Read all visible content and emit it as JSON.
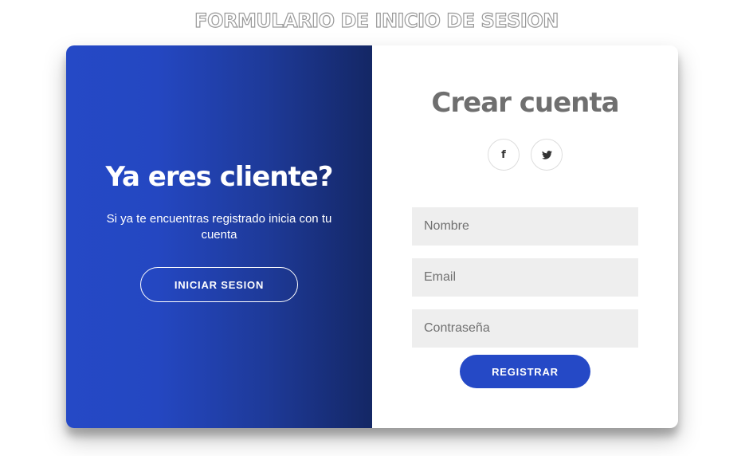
{
  "page": {
    "title": "FORMULARIO DE INICIO DE SESION"
  },
  "colors": {
    "accent": "#2549c6",
    "gradient_start": "#2549c6",
    "gradient_end": "#142765",
    "input_background": "#eeeeee",
    "form_title": "#6f6f6f"
  },
  "overlay": {
    "title": "Ya eres cliente?",
    "text": "Si ya te encuentras registrado inicia con tu cuenta",
    "button_label": "INICIAR SESION"
  },
  "form": {
    "title": "Crear cuenta",
    "social": [
      {
        "icon": "facebook-icon",
        "glyph": "f"
      },
      {
        "icon": "twitter-icon",
        "glyph": "🐦"
      }
    ],
    "fields": {
      "name_placeholder": "Nombre",
      "email_placeholder": "Email",
      "password_placeholder": "Contraseña"
    },
    "submit_label": "REGISTRAR"
  }
}
